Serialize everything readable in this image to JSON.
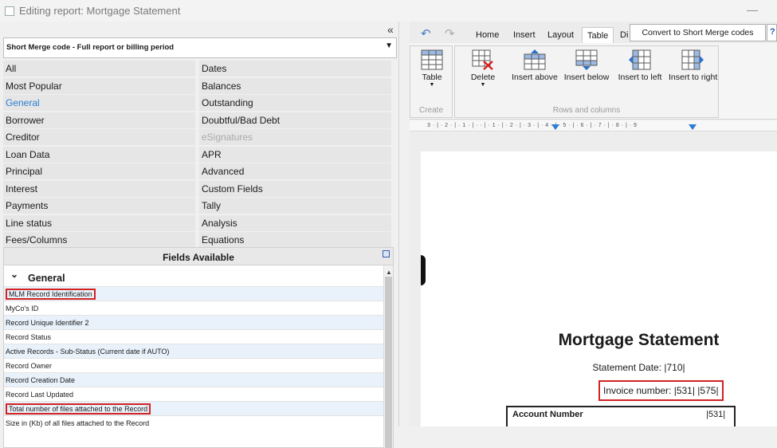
{
  "window": {
    "title": "Editing report: Mortgage Statement",
    "minimize_label": "—"
  },
  "left": {
    "collapse_label": "«",
    "merge_dropdown": "Short Merge code - Full report or billing period",
    "categories_left": [
      "All",
      "Most Popular",
      "General",
      "Borrower",
      "Creditor",
      "Loan Data",
      "Principal",
      "Interest",
      "Payments",
      "Line status",
      "Fees/Columns"
    ],
    "categories_right": [
      "Dates",
      "Balances",
      "Outstanding",
      "Doubtful/Bad Debt",
      "eSignatures",
      "APR",
      "Advanced",
      "Custom Fields",
      "Tally",
      "Analysis",
      "Equations"
    ],
    "fields_header": "Fields Available",
    "group_title": "General",
    "fields": [
      "MLM Record Identification",
      "MyCo's ID",
      "Record Unique Identifier 2",
      "Record Status",
      "Active Records - Sub-Status (Current date if AUTO)",
      "Record Owner",
      "Record Creation Date",
      "Record Last Updated",
      "Total number of files attached to the Record",
      "Size in (Kb) of all files attached to the Record"
    ]
  },
  "ribbon": {
    "tabs": [
      "Home",
      "Insert",
      "Layout",
      "Table",
      "Di"
    ],
    "convert_button": "Convert to Short Merge codes",
    "help_label": "?",
    "create_group": "Create",
    "rows_group": "Rows and columns",
    "buttons": [
      "Table",
      "Delete",
      "Insert above",
      "Insert below",
      "Insert to left",
      "Insert to right"
    ]
  },
  "ruler_text": "3 · | · 2 · | · 1 · | ·   · | · 1 · | · 2 · | · 3 · | · 4 · | · 5 · | · 6 · | · 7 · | · 8 · | · 9",
  "document": {
    "title": "Mortgage Statement",
    "statement_date": "Statement Date: |710|",
    "invoice_number": "Invoice number: |531| |575|",
    "account_label": "Account Number",
    "account_value": "|531|"
  },
  "colors": {
    "selected_category": "#2b7cd3",
    "highlight_box": "#d32222",
    "row_alt": "#e9f2fb"
  }
}
